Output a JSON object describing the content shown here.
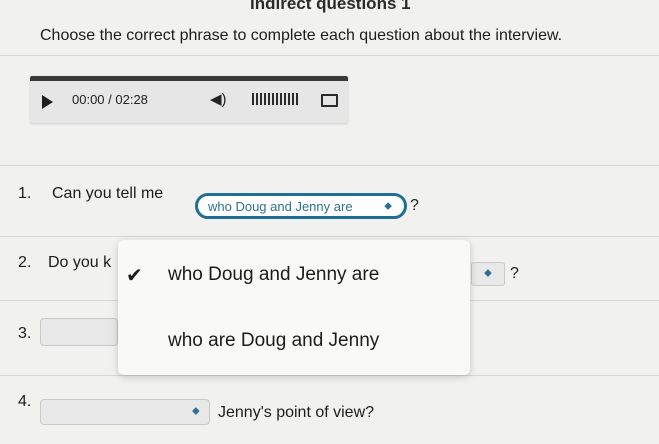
{
  "page": {
    "heading": "Indirect questions 1",
    "instructions": "Choose the correct phrase to complete each question about the interview."
  },
  "audio": {
    "time": "00:00 / 02:28"
  },
  "questions": [
    {
      "number": "1.",
      "text_before": "Can you tell me",
      "selected": "who Doug and Jenny are",
      "text_after": "?"
    },
    {
      "number": "2.",
      "text_before": "Do you k",
      "text_after": "?"
    },
    {
      "number": "3."
    },
    {
      "number": "4.",
      "text_after": "Jenny's point of view?"
    }
  ],
  "dropdown": {
    "options": [
      {
        "label": "who Doug and Jenny are",
        "checked": true
      },
      {
        "label": "who are Doug and Jenny",
        "checked": false
      }
    ]
  },
  "icons": {
    "play": "play-icon",
    "volume": "volume-icon",
    "seek": "waveform-icon",
    "download": "download-icon",
    "check": "check-icon",
    "select_arrows": "select-arrows-icon"
  },
  "colors": {
    "accent": "#1f6e93",
    "background": "#f1f1ef"
  }
}
